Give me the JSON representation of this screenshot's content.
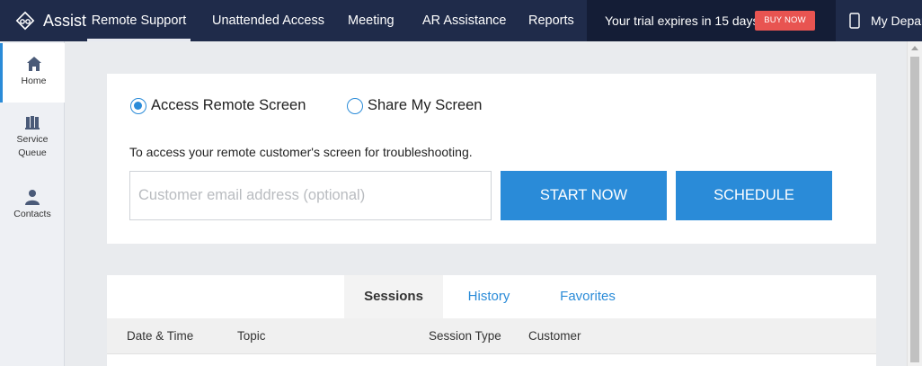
{
  "brand": {
    "name": "Assist"
  },
  "nav": {
    "items": [
      {
        "label": "Remote Support",
        "active": true
      },
      {
        "label": "Unattended Access",
        "active": false
      },
      {
        "label": "Meeting",
        "active": false
      },
      {
        "label": "AR Assistance",
        "active": false
      },
      {
        "label": "Reports",
        "active": false
      }
    ],
    "trial_text": "Your trial expires in 15 days.",
    "buy_label": "BUY NOW",
    "department": "My Depar"
  },
  "sidebar": {
    "items": [
      {
        "label": "Home",
        "icon": "home-icon"
      },
      {
        "label": "Service Queue",
        "icon": "service-queue-icon"
      },
      {
        "label": "Contacts",
        "icon": "contacts-icon"
      }
    ]
  },
  "access": {
    "option_remote": "Access Remote Screen",
    "option_share": "Share My Screen",
    "selected": "Access Remote Screen",
    "description": "To access your remote customer's screen for troubleshooting.",
    "email_placeholder": "Customer email address (optional)",
    "email_value": "",
    "start_label": "START NOW",
    "schedule_label": "SCHEDULE"
  },
  "sessions": {
    "tabs": [
      "Sessions",
      "History",
      "Favorites"
    ],
    "columns": [
      "Date & Time",
      "Topic",
      "Session Type",
      "Customer"
    ]
  },
  "colors": {
    "nav_bg": "#1f2b4a",
    "accent": "#2a8bd8",
    "buy_button": "#e85451"
  }
}
